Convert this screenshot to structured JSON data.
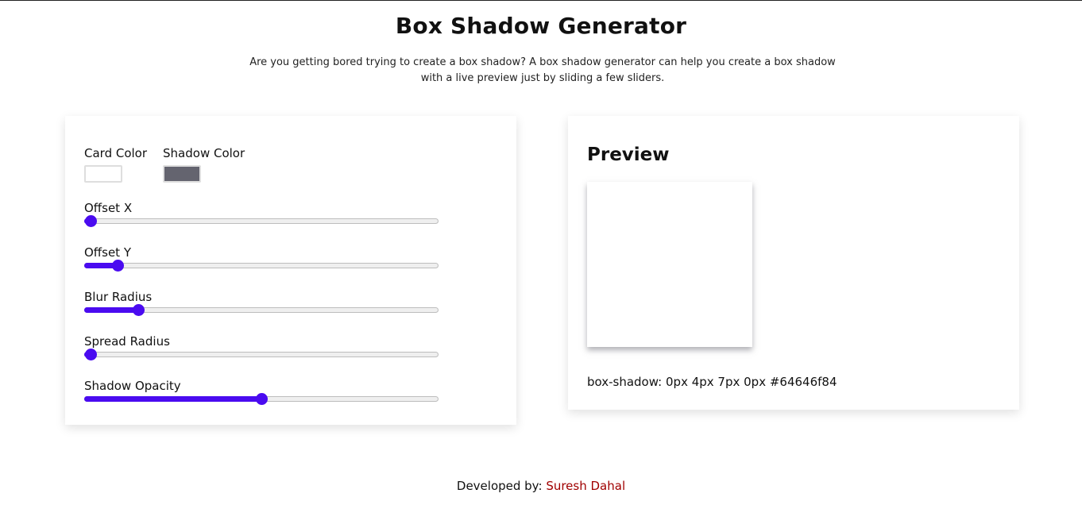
{
  "page": {
    "title": "Box Shadow Generator",
    "description": "Are you getting bored trying to create a box shadow? A box shadow generator can help you create a box shadow with a live preview just by sliding a few sliders."
  },
  "controls": {
    "card_color": {
      "label": "Card Color",
      "value": "#ffffff"
    },
    "shadow_color": {
      "label": "Shadow Color",
      "value": "#64646f"
    },
    "sliders": [
      {
        "label": "Offset X",
        "fraction": 0.0
      },
      {
        "label": "Offset Y",
        "fraction": 0.08
      },
      {
        "label": "Blur Radius",
        "fraction": 0.14
      },
      {
        "label": "Spread Radius",
        "fraction": 0.0
      },
      {
        "label": "Shadow Opacity",
        "fraction": 0.5
      }
    ],
    "accent_color": "#4a0bf0"
  },
  "preview": {
    "title": "Preview",
    "code": "box-shadow: 0px 4px 7px 0px #64646f84"
  },
  "footer": {
    "prefix": "Developed by:",
    "author": "Suresh Dahal",
    "author_color": "#a00000"
  }
}
